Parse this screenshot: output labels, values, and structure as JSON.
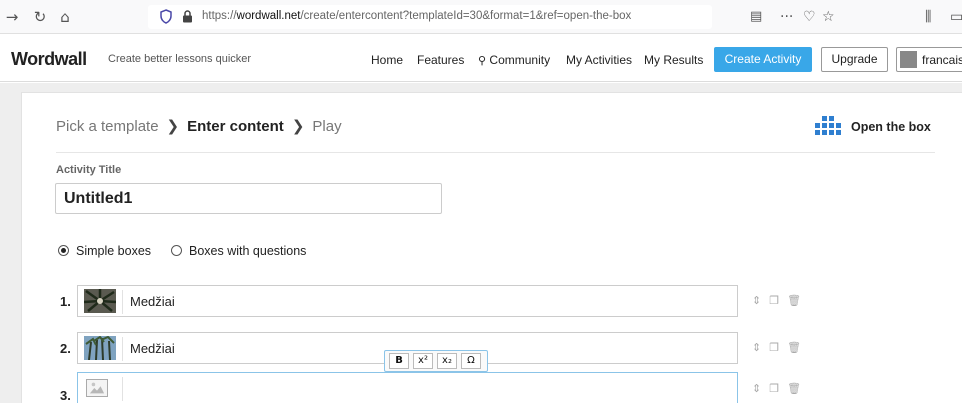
{
  "browser": {
    "url_prefix": "https://",
    "url_domain": "wordwall.net",
    "url_path": "/create/entercontent?templateId=30&format=1&ref=open-the-box"
  },
  "header": {
    "logo": "Wordwall",
    "tagline": "Create better lessons quicker",
    "nav": [
      "Home",
      "Features",
      "Community",
      "My Activities",
      "My Results"
    ],
    "create_button": "Create Activity",
    "upgrade_button": "Upgrade",
    "user_name": "francais"
  },
  "breadcrumb": {
    "step1": "Pick a template",
    "step2": "Enter content",
    "step3": "Play",
    "separator": "❯"
  },
  "template": {
    "name": "Open the box",
    "icon_color": "#2f7fd0"
  },
  "form": {
    "title_label": "Activity Title",
    "title_value": "Untitled1",
    "mode_options": [
      "Simple boxes",
      "Boxes with questions"
    ],
    "selected_mode": "Simple boxes"
  },
  "items": [
    {
      "number": "1.",
      "text": "Medžiai"
    },
    {
      "number": "2.",
      "text": "Medžiai"
    },
    {
      "number": "3.",
      "text": ""
    }
  ],
  "rte_toolbar": {
    "bold": "B",
    "superscript": "x²",
    "subscript": "x₂",
    "symbol": "Ω"
  },
  "colors": {
    "accent": "#39a7e8",
    "focus": "#8bc4e8"
  }
}
